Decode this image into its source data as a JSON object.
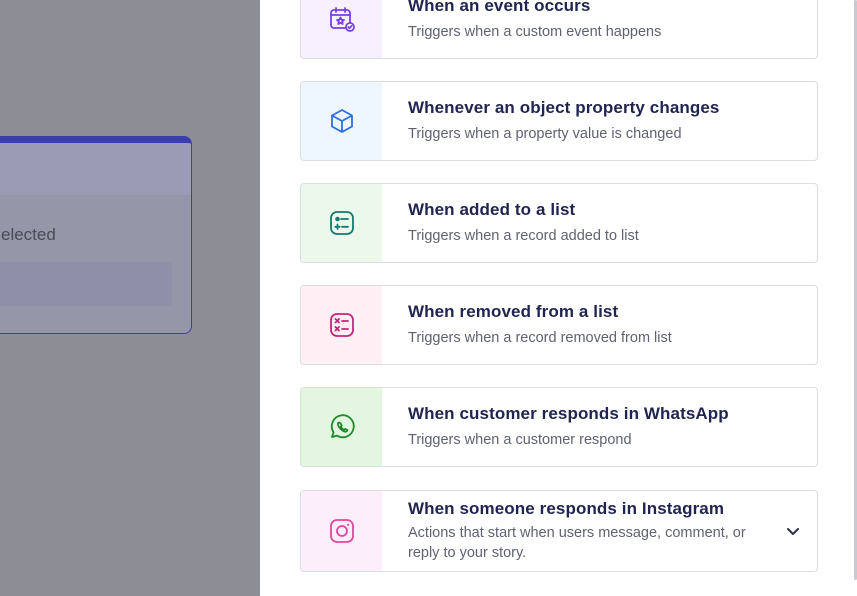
{
  "background": {
    "card_text": "elected"
  },
  "triggers": [
    {
      "title": "When an event occurs",
      "description": "Triggers when a custom event happens",
      "icon": "calendar-star-icon",
      "icon_bg": "#f6f0ff",
      "icon_color": "#7b3fe4"
    },
    {
      "title": "Whenever an object property changes",
      "description": "Triggers when a property value is changed",
      "icon": "cube-icon",
      "icon_bg": "#eef6ff",
      "icon_color": "#2f6fd8"
    },
    {
      "title": "When added to a list",
      "description": "Triggers when a record added to list",
      "icon": "list-add-icon",
      "icon_bg": "#edf8ec",
      "icon_color": "#127a6e"
    },
    {
      "title": "When removed from a list",
      "description": "Triggers when a record removed from list",
      "icon": "list-remove-icon",
      "icon_bg": "#fff0f5",
      "icon_color": "#c2277a"
    },
    {
      "title": "When customer responds in WhatsApp",
      "description": "Triggers when a customer respond",
      "icon": "whatsapp-icon",
      "icon_bg": "#e3f6df",
      "icon_color": "#1f8a2a"
    },
    {
      "title": "When someone responds in Instagram",
      "description": "Actions that start when users message, comment, or reply to your story.",
      "icon": "instagram-icon",
      "icon_bg": "#fdeefb",
      "icon_color": "#e0479e"
    }
  ]
}
